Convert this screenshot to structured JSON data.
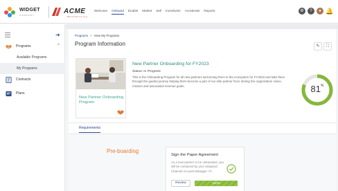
{
  "brand": {
    "logo1_name": "WIDGET",
    "logo1_tag": "COMPANY",
    "logo2_name": "ACME",
    "logo2_tag": "Manufacturing"
  },
  "nav": {
    "items": [
      "Welcome",
      "Onboard",
      "Enable",
      "Market",
      "Sell",
      "Incentivize",
      "Accelerate",
      "Reports"
    ],
    "active_index": 1
  },
  "sidebar": {
    "programs_label": "Programs",
    "available_programs": "Available Programs",
    "my_programs": "My Programs",
    "contracts": "Contracts",
    "plans": "Plans"
  },
  "breadcrumb": {
    "root": "Programs",
    "current": "View My Programs"
  },
  "page": {
    "title": "Program Information"
  },
  "program": {
    "tile_title": "New Partner Onboarding Program",
    "name": "New Partner Onboarding for FY2023",
    "status_label": "Status:",
    "status": "In Progress",
    "description": "This is the Onboarding Program for all new partners welcoming them to the ecosystem for FY2023 and take them through the guided journey helping them become a part of our elite partner force driving the organization vision, mission and associated revenue goals.",
    "progress_percent": 81,
    "progress_suffix": "%"
  },
  "tabs": {
    "requirements": "Requirements"
  },
  "stage": {
    "title": "Pre-boarding"
  },
  "task": {
    "title": "Sign the Paper Agreement",
    "description": "As a new partner to be onboarded, you will be contacted by your assigned Channel Account Manager / P...",
    "review_label": "Review",
    "progress_percent": 100,
    "progress_label": "100%"
  },
  "colors": {
    "primary": "#2d4a8a",
    "teal": "#2d8a7d",
    "ring": "#86b73a",
    "stage": "#e07b2f"
  }
}
